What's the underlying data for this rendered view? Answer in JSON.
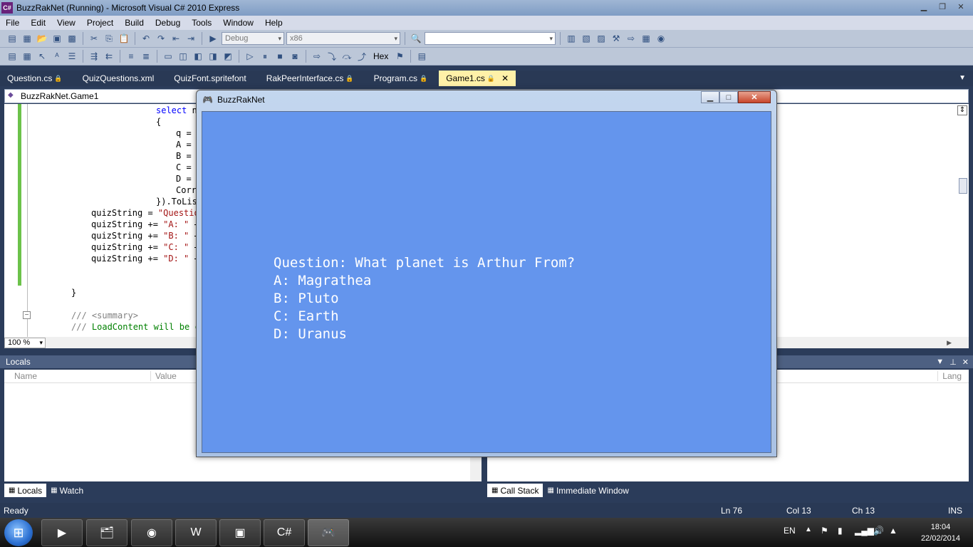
{
  "window": {
    "title": "BuzzRakNet (Running) - Microsoft Visual C# 2010 Express"
  },
  "menu": [
    "File",
    "Edit",
    "View",
    "Project",
    "Build",
    "Debug",
    "Tools",
    "Window",
    "Help"
  ],
  "toolbar": {
    "config": "Debug",
    "platform": "x86",
    "hex_label": "Hex"
  },
  "doc_tabs": [
    {
      "label": "Question.cs",
      "locked": true
    },
    {
      "label": "QuizQuestions.xml",
      "locked": false
    },
    {
      "label": "QuizFont.spritefont",
      "locked": false
    },
    {
      "label": "RakPeerInterface.cs",
      "locked": true
    },
    {
      "label": "Program.cs",
      "locked": true
    },
    {
      "label": "Game1.cs",
      "locked": true,
      "active": true
    }
  ],
  "editor": {
    "navigation": "BuzzRakNet.Game1",
    "zoom": "100 %",
    "lines": [
      {
        "kw": "select",
        "text": " n"
      },
      {
        "text": "{"
      },
      {
        "text": "q ="
      },
      {
        "text": "A ="
      },
      {
        "text": "B ="
      },
      {
        "text": "C ="
      },
      {
        "text": "D ="
      },
      {
        "text": "Corr"
      },
      {
        "text": "}).ToLis"
      },
      {
        "text": "quizString = ",
        "str": "\"Questio"
      },
      {
        "text": "quizString += ",
        "str": "\"A: \"",
        "tail": " +"
      },
      {
        "text": "quizString += ",
        "str": "\"B: \"",
        "tail": " +"
      },
      {
        "text": "quizString += ",
        "str": "\"C: \"",
        "tail": " +"
      },
      {
        "text": "quizString += ",
        "str": "\"D: \"",
        "tail": " +"
      },
      {
        "text": "}"
      },
      {
        "gray": "/// <summary>"
      },
      {
        "gray": "///",
        "cm": " LoadContent will be c"
      }
    ]
  },
  "locals": {
    "title": "Locals",
    "columns": {
      "name": "Name",
      "value": "Value",
      "type": "Lang"
    }
  },
  "panel_tabs_left": [
    {
      "label": "Locals",
      "active": true
    },
    {
      "label": "Watch"
    }
  ],
  "panel_tabs_right": [
    {
      "label": "Call Stack",
      "active": true
    },
    {
      "label": "Immediate Window"
    }
  ],
  "status": {
    "state": "Ready",
    "line": "Ln 76",
    "col": "Col 13",
    "ch": "Ch 13",
    "mode": "INS"
  },
  "game": {
    "title": "BuzzRakNet",
    "question": "Question: What planet is Arthur From?",
    "answers": [
      "A: Magrathea",
      "B: Pluto",
      "C: Earth",
      "D: Uranus"
    ],
    "background": "#6495ed"
  },
  "taskbar": {
    "language": "EN",
    "time": "18:04",
    "date": "22/02/2014"
  }
}
